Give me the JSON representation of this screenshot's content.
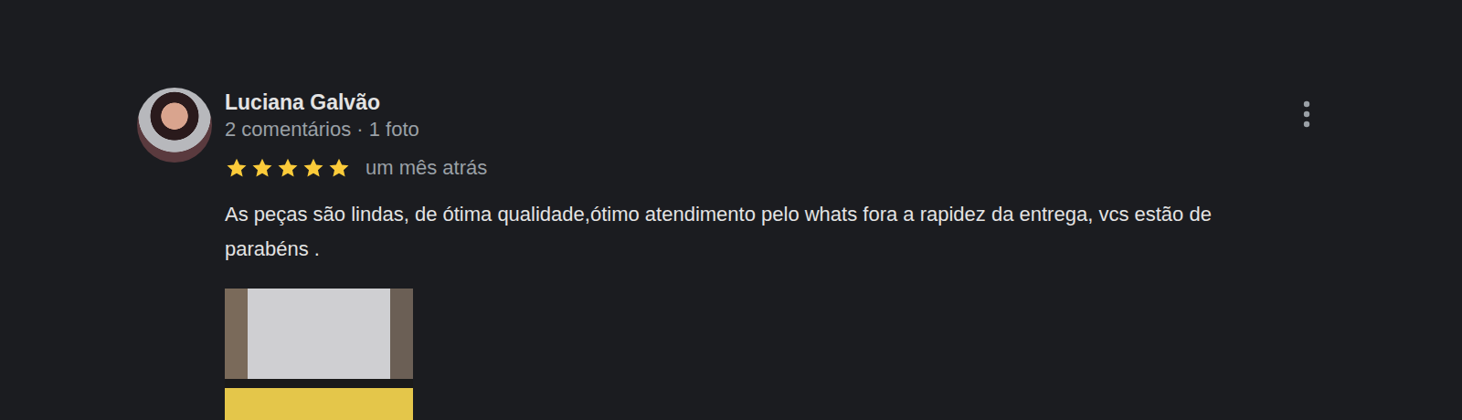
{
  "review": {
    "author": "Luciana Galvão",
    "subtitle": "2 comentários · 1 foto",
    "stars": 5,
    "time": "um mês atrás",
    "text": "As peças são lindas, de ótima qualidade,ótimo atendimento pelo whats fora a rapidez da entrega, vcs estão de parabéns ."
  }
}
